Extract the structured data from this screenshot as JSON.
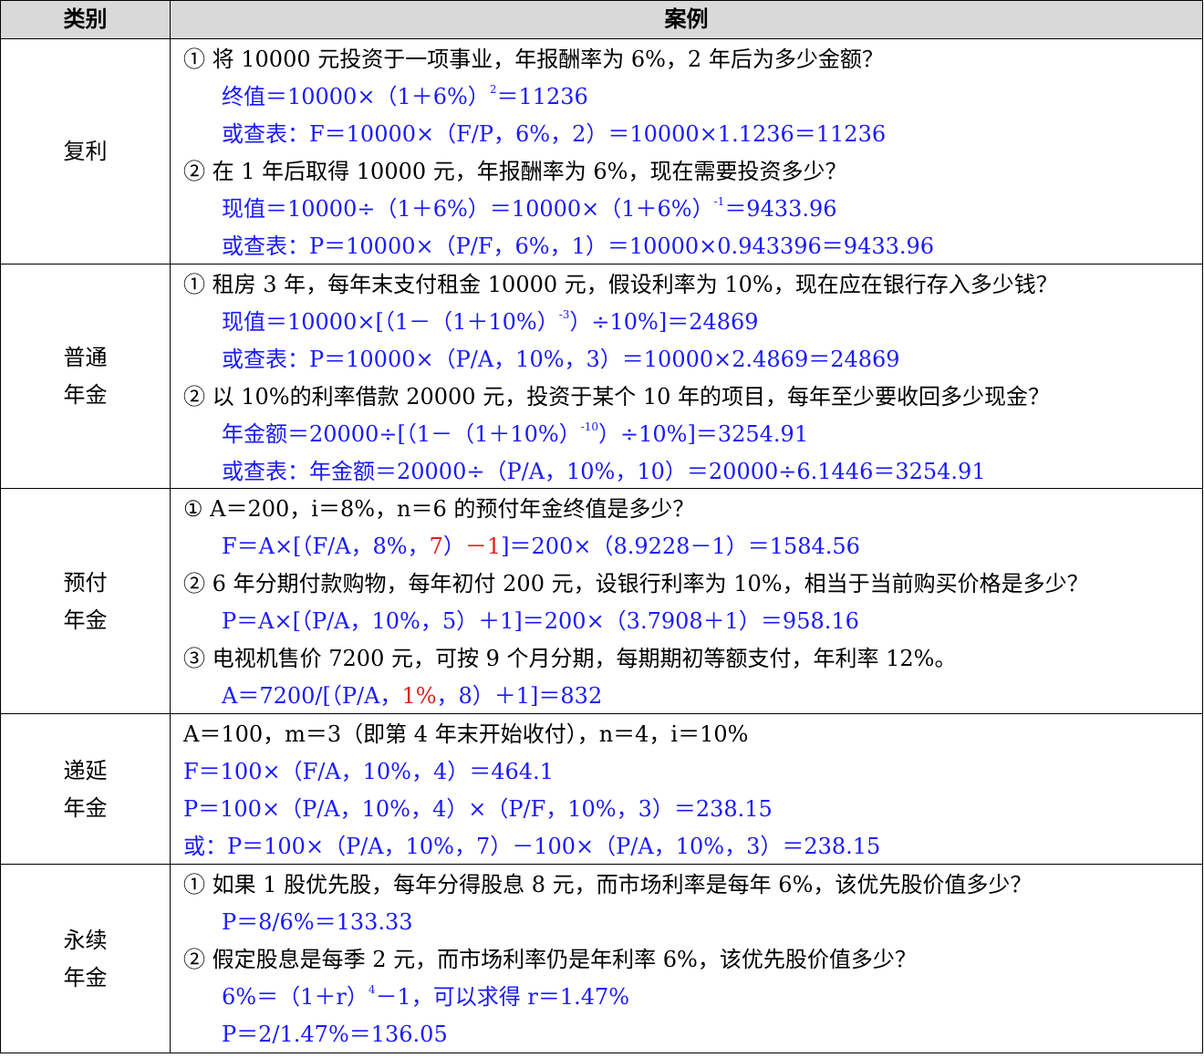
{
  "header": {
    "category": "类别",
    "case": "案例"
  },
  "rows": [
    {
      "category": [
        "复利"
      ],
      "lines": [
        {
          "t": "① 将 10000 元投资于一项事业，年报酬率为 6%，2 年后为多少金额？"
        },
        {
          "a": "终值＝10000×（1＋6%）",
          "sup": "2",
          "b": "＝11236"
        },
        {
          "a": "或查表：F＝10000×（F/P，6%，2）＝10000×1.1236＝11236"
        },
        {
          "t": "② 在 1 年后取得 10000 元，年报酬率为 6%，现在需要投资多少？"
        },
        {
          "a": "现值＝10000÷（1＋6%）＝10000×（1＋6%）",
          "sup": "-1",
          "b": "＝9433.96"
        },
        {
          "a": "或查表：P＝10000×（P/F，6%，1）＝10000×0.943396＝9433.96"
        }
      ]
    },
    {
      "category": [
        "普通",
        "年金"
      ],
      "lines": [
        {
          "t": "① 租房 3 年，每年末支付租金 10000 元，假设利率为 10%，现在应在银行存入多少钱？"
        },
        {
          "a": "现值＝10000×[（1－（1＋10%）",
          "sup": "-3",
          "b": "）÷10%]＝24869"
        },
        {
          "a": "或查表：P＝10000×（P/A，10%，3）＝10000×2.4869＝24869"
        },
        {
          "t": "② 以 10%的利率借款 20000 元，投资于某个 10 年的项目，每年至少要收回多少现金？"
        },
        {
          "a": "年金额＝20000÷[（1－（1＋10%）",
          "sup": "-10",
          "b": "）÷10%]＝3254.91"
        },
        {
          "a": "或查表：年金额＝20000÷（P/A，10%，10）＝20000÷6.1446＝3254.91"
        }
      ]
    },
    {
      "category": [
        "预付",
        "年金"
      ],
      "lines": [
        {
          "t": "① A＝200，i＝8%，n＝6 的预付年金终值是多少？"
        },
        {
          "a": "F＝A×[（F/A，8%，",
          "r1": "7",
          "b": "）",
          "r2": "－1",
          "c": "]＝200×（8.9228－1）＝1584.56"
        },
        {
          "t": "② 6 年分期付款购物，每年初付 200 元，设银行利率为 10%，相当于当前购买价格是多少？"
        },
        {
          "a": "P＝A×[（P/A，10%，5）＋1]＝200×（3.7908＋1）＝958.16"
        },
        {
          "t": "③ 电视机售价 7200 元，可按 9 个月分期，每期期初等额支付，年利率 12%。"
        },
        {
          "a": "A＝7200/[（P/A，",
          "r1": "1%",
          "b": "，8）＋1]＝832"
        }
      ]
    },
    {
      "category": [
        "递延",
        "年金"
      ],
      "lines": [
        {
          "t": "A＝100，m＝3（即第 4 年末开始收付），n＝4，i＝10%"
        },
        {
          "a": "F＝100×（F/A，10%，4）＝464.1"
        },
        {
          "a": "P＝100×（P/A，10%，4）×（P/F，10%，3）＝238.15"
        },
        {
          "a": "或：P＝100×（P/A，10%，7）－100×（P/A，10%，3）＝238.15"
        }
      ]
    },
    {
      "category": [
        "永续",
        "年金"
      ],
      "lines": [
        {
          "t": "① 如果 1 股优先股，每年分得股息 8 元，而市场利率是每年 6%，该优先股价值多少？"
        },
        {
          "a": "P＝8/6%＝133.33"
        },
        {
          "t": "② 假定股息是每季 2 元，而市场利率仍是年利率 6%，该优先股价值多少？"
        },
        {
          "a": "6%＝（1＋r）",
          "sup": "4",
          "b": "－1，可以求得 r＝1.47%"
        },
        {
          "a": "P＝2/1.47%＝136.05"
        }
      ]
    }
  ]
}
